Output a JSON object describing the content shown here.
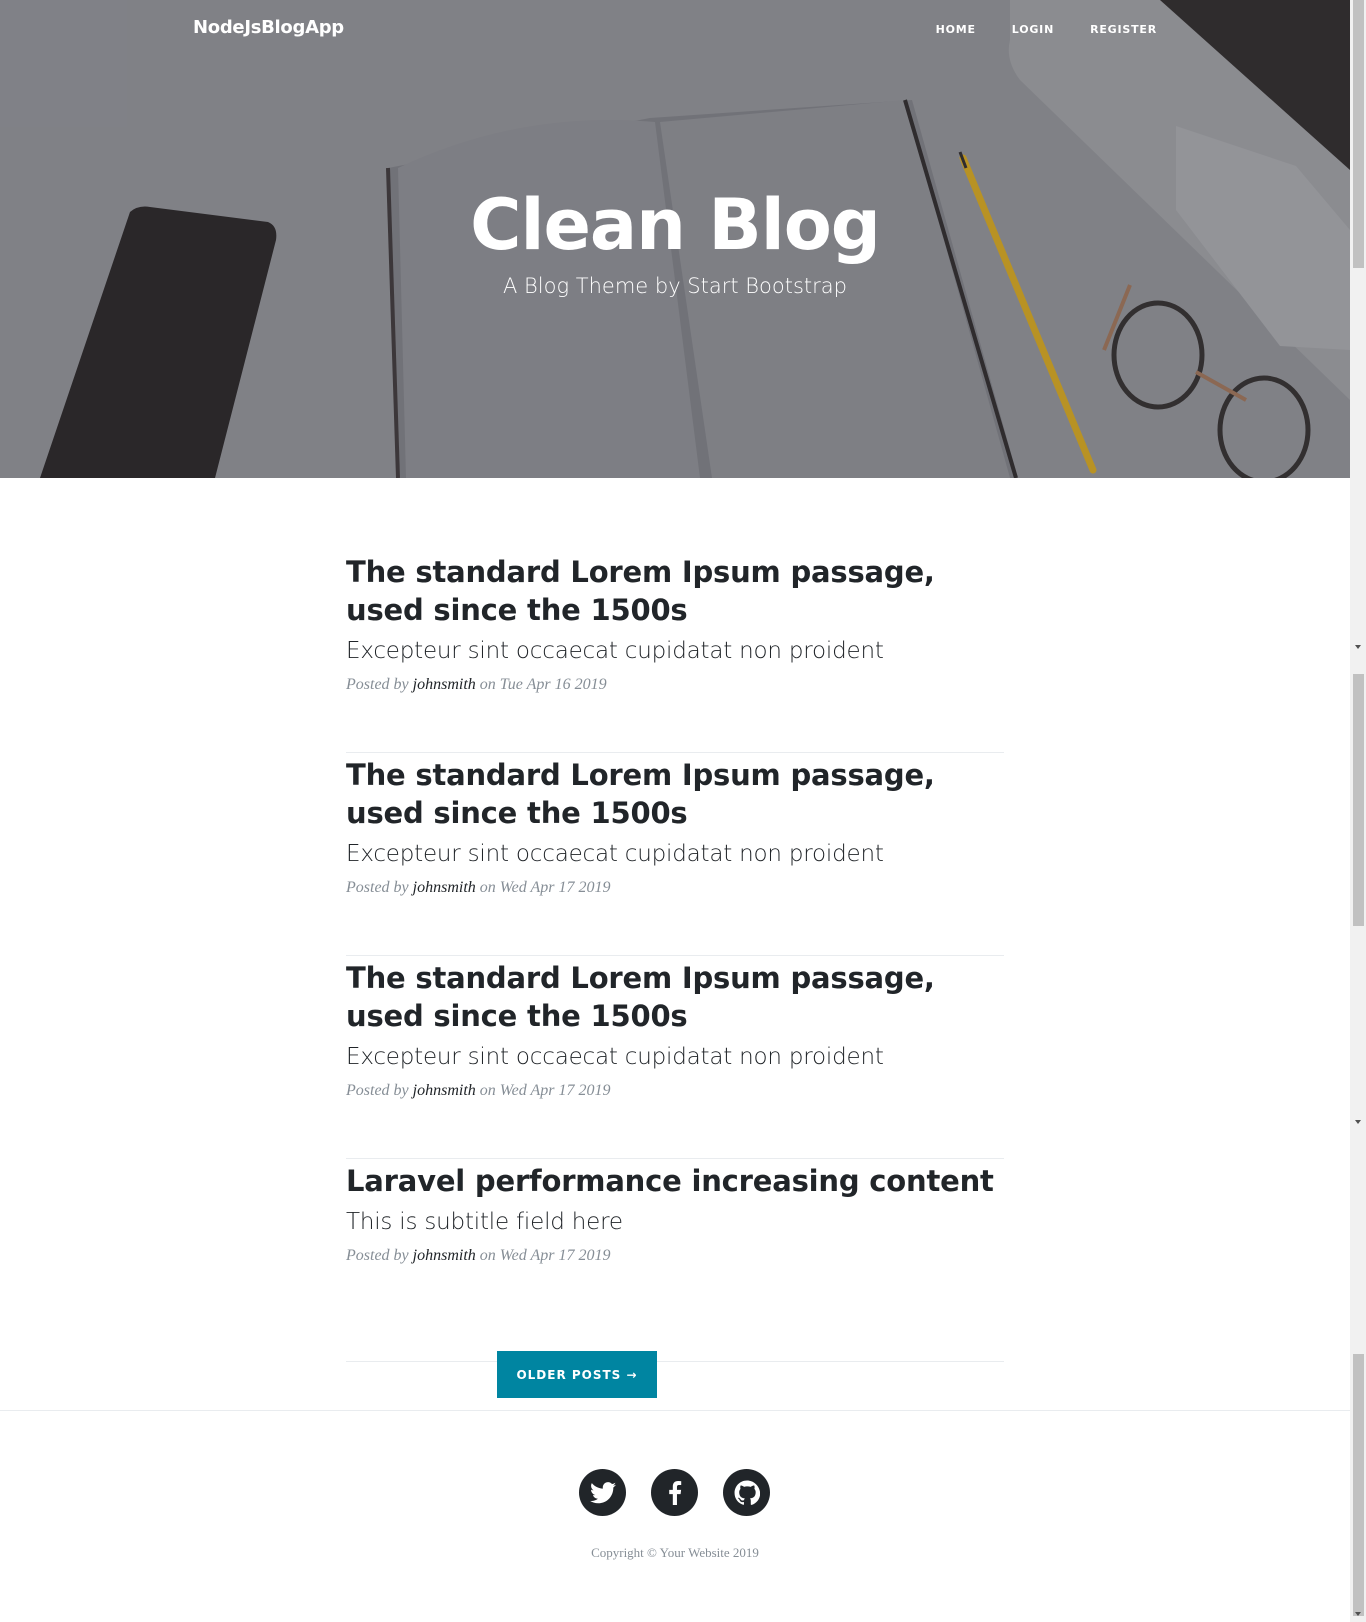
{
  "navbar": {
    "brand": "NodeJsBlogApp",
    "links": [
      "HOME",
      "LOGIN",
      "REGISTER"
    ]
  },
  "header": {
    "title": "Clean Blog",
    "subtitle": "A Blog Theme by Start Bootstrap"
  },
  "posts": [
    {
      "title": "The standard Lorem Ipsum passage, used since the 1500s",
      "subtitle": "Excepteur sint occaecat cupidatat non proident",
      "posted_by": "Posted by",
      "author": "johnsmith",
      "on": "on",
      "date": "Tue Apr 16 2019"
    },
    {
      "title": "The standard Lorem Ipsum passage, used since the 1500s",
      "subtitle": "Excepteur sint occaecat cupidatat non proident",
      "posted_by": "Posted by",
      "author": "johnsmith",
      "on": "on",
      "date": "Wed Apr 17 2019"
    },
    {
      "title": "The standard Lorem Ipsum passage, used since the 1500s",
      "subtitle": "Excepteur sint occaecat cupidatat non proident",
      "posted_by": "Posted by",
      "author": "johnsmith",
      "on": "on",
      "date": "Wed Apr 17 2019"
    },
    {
      "title": "Laravel performance increasing content",
      "subtitle": "This is subtitle field here",
      "posted_by": "Posted by",
      "author": "johnsmith",
      "on": "on",
      "date": "Wed Apr 17 2019"
    }
  ],
  "pager": {
    "older_label": "OLDER POSTS →"
  },
  "footer": {
    "social": [
      {
        "name": "twitter-icon"
      },
      {
        "name": "facebook-icon"
      },
      {
        "name": "github-icon"
      }
    ],
    "copyright": "Copyright © Your Website 2019"
  },
  "colors": {
    "accent": "#0085a1",
    "text": "#212529",
    "muted": "#868e96"
  }
}
